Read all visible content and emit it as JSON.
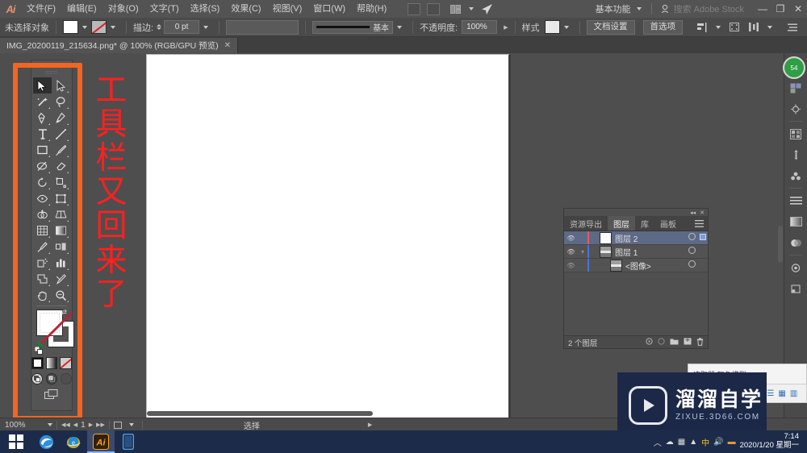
{
  "menubar": {
    "logo": "Ai",
    "items": [
      {
        "label": "文件(F)"
      },
      {
        "label": "编辑(E)"
      },
      {
        "label": "对象(O)"
      },
      {
        "label": "文字(T)"
      },
      {
        "label": "选择(S)"
      },
      {
        "label": "效果(C)"
      },
      {
        "label": "视图(V)"
      },
      {
        "label": "窗口(W)"
      },
      {
        "label": "帮助(H)"
      }
    ],
    "workspace_label": "基本功能",
    "search_label": "搜索 Adobe Stock",
    "minimize": "—",
    "restore": "❐",
    "close": "✕"
  },
  "controlbar": {
    "selection_status": "未选择对象",
    "stroke_label": "描边:",
    "stroke_weight": "0 pt",
    "stroke_profile_name": "基本",
    "opacity_label": "不透明度:",
    "opacity_value": "100%",
    "style_label": "样式",
    "doc_setup_label": "文档设置",
    "preferences_label": "首选项"
  },
  "documenttab": {
    "title": "IMG_20200119_215634.png* @ 100% (RGB/GPU 预览)",
    "close": "✕"
  },
  "toolbar": {
    "tools": [
      {
        "name": "selection-tool",
        "label": "选择工具"
      },
      {
        "name": "direct-selection-tool",
        "label": "直接选择工具"
      },
      {
        "name": "magic-wand-tool",
        "label": "魔棒工具"
      },
      {
        "name": "lasso-tool",
        "label": "套索工具"
      },
      {
        "name": "pen-tool",
        "label": "钢笔工具"
      },
      {
        "name": "curvature-tool",
        "label": "曲率工具"
      },
      {
        "name": "type-tool",
        "label": "文字工具"
      },
      {
        "name": "line-segment-tool",
        "label": "直线段工具"
      },
      {
        "name": "rectangle-tool",
        "label": "矩形工具"
      },
      {
        "name": "paintbrush-tool",
        "label": "画笔工具"
      },
      {
        "name": "shaper-tool",
        "label": "Shaper 工具"
      },
      {
        "name": "eraser-tool",
        "label": "橡皮擦工具"
      },
      {
        "name": "rotate-tool",
        "label": "旋转工具"
      },
      {
        "name": "scale-tool",
        "label": "比例缩放工具"
      },
      {
        "name": "width-tool",
        "label": "宽度工具"
      },
      {
        "name": "free-transform-tool",
        "label": "自由变换工具"
      },
      {
        "name": "shape-builder-tool",
        "label": "形状生成器工具"
      },
      {
        "name": "perspective-grid-tool",
        "label": "透视网格工具"
      },
      {
        "name": "mesh-tool",
        "label": "网格工具"
      },
      {
        "name": "gradient-tool",
        "label": "渐变工具"
      },
      {
        "name": "eyedropper-tool",
        "label": "吸管工具"
      },
      {
        "name": "blend-tool",
        "label": "混合工具"
      },
      {
        "name": "symbol-sprayer-tool",
        "label": "符号喷枪工具"
      },
      {
        "name": "column-graph-tool",
        "label": "柱形图工具"
      },
      {
        "name": "artboard-tool",
        "label": "画板工具"
      },
      {
        "name": "slice-tool",
        "label": "切片工具"
      },
      {
        "name": "hand-tool",
        "label": "抓手工具"
      },
      {
        "name": "zoom-tool",
        "label": "缩放工具"
      }
    ],
    "fill_color": "#ffffff",
    "stroke_color": "#ffffff",
    "modes": [
      "颜色",
      "渐变",
      "无"
    ],
    "draw_modes": [
      "正常绘图",
      "背面绘图",
      "内部绘图"
    ],
    "screen_mode_label": "更改屏幕模式"
  },
  "annotation": {
    "text": "工具栏又回来了",
    "rect_color": "#f26522",
    "text_color": "#ff2020"
  },
  "layers_panel": {
    "tabs": [
      {
        "label": "资源导出",
        "active": false
      },
      {
        "label": "图层",
        "active": true
      },
      {
        "label": "库",
        "active": false
      },
      {
        "label": "画板",
        "active": false
      }
    ],
    "menu_icon": "panel-menu-icon",
    "rows": [
      {
        "name": "图层 2",
        "visible": true,
        "locked": false,
        "selected": true,
        "indent": 0,
        "color": "#e05c5c",
        "thumb": "blank"
      },
      {
        "name": "图层 1",
        "visible": true,
        "locked": false,
        "selected": false,
        "indent": 0,
        "color": "#4a74d6",
        "thumb": "image",
        "expanded": true
      },
      {
        "name": "<图像>",
        "visible": true,
        "locked": false,
        "selected": false,
        "indent": 1,
        "color": "#4a74d6",
        "thumb": "image"
      }
    ],
    "footer_count": "2 个图层",
    "footer_icons": [
      "locate-object-icon",
      "make-clipping-mask-icon",
      "new-sublayer-icon",
      "new-layer-icon",
      "delete-layer-icon"
    ]
  },
  "right_dock": {
    "items": [
      {
        "name": "libraries-icon"
      },
      {
        "name": "properties-icon"
      },
      {
        "name": "color-icon"
      },
      {
        "name": "swatches-icon"
      },
      {
        "name": "brushes-icon"
      },
      {
        "name": "symbols-icon"
      },
      {
        "name": "stroke-icon"
      },
      {
        "name": "gradient-icon"
      },
      {
        "name": "transparency-icon"
      },
      {
        "name": "appearance-icon"
      },
      {
        "name": "graphic-styles-icon"
      }
    ],
    "badge_text": "54"
  },
  "statusbar": {
    "zoom": "100%",
    "page_number": "1",
    "tool_status": "选择"
  },
  "taskbar": {
    "start": "windows-start-icon",
    "apps": [
      {
        "name": "edge-icon",
        "active": false
      },
      {
        "name": "internet-explorer-icon",
        "active": false
      },
      {
        "name": "illustrator-icon",
        "active": true
      },
      {
        "name": "phone-link-icon",
        "active": false
      }
    ],
    "tray_icons": [
      "chevron-up-icon",
      "cloud-icon",
      "network-icon",
      "speaker-icon",
      "input-method-icon",
      "battery-icon"
    ],
    "clock_time": "7:14",
    "clock_date": "2020/1/20 星期一"
  },
  "watermark": {
    "brand": "溜溜自学",
    "url": "ZIXUE.3D66.COM",
    "bg_color": "#1c2847"
  },
  "popup": {
    "text": "选取器  颜色模型"
  }
}
